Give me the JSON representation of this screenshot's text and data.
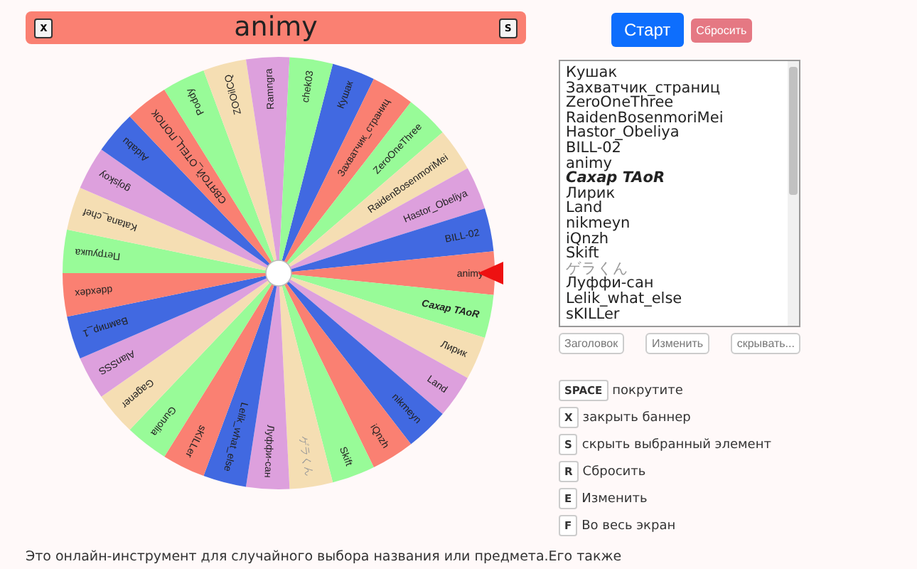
{
  "banner": {
    "close_key": "x",
    "title": "animy",
    "hide_key": "s"
  },
  "wheel": {
    "items": [
      {
        "label": "Кушак",
        "highlighted": false,
        "dimmed": false
      },
      {
        "label": "Захватчик_страниц",
        "highlighted": false,
        "dimmed": false
      },
      {
        "label": "ZeroOneThree",
        "highlighted": false,
        "dimmed": false
      },
      {
        "label": "RaidenBosenmoriMei",
        "highlighted": false,
        "dimmed": false
      },
      {
        "label": "Hastor_Obeliya",
        "highlighted": false,
        "dimmed": false
      },
      {
        "label": "BILL-02",
        "highlighted": false,
        "dimmed": false
      },
      {
        "label": "animy",
        "highlighted": false,
        "dimmed": false
      },
      {
        "label": "Сахар  TAoR",
        "highlighted": true,
        "dimmed": false
      },
      {
        "label": "Лирик",
        "highlighted": false,
        "dimmed": false
      },
      {
        "label": "Land",
        "highlighted": false,
        "dimmed": false
      },
      {
        "label": "nikmeyn",
        "highlighted": false,
        "dimmed": false
      },
      {
        "label": "iQnzh",
        "highlighted": false,
        "dimmed": false
      },
      {
        "label": "Skift",
        "highlighted": false,
        "dimmed": false
      },
      {
        "label": "ゲラくん",
        "highlighted": false,
        "dimmed": true
      },
      {
        "label": "Луффи-сан",
        "highlighted": false,
        "dimmed": false
      },
      {
        "label": "Lelik_what_else",
        "highlighted": false,
        "dimmed": false
      },
      {
        "label": "sKILLer",
        "highlighted": false,
        "dimmed": false
      },
      {
        "label": "Gunolia",
        "highlighted": false,
        "dimmed": false
      },
      {
        "label": "Gagener",
        "highlighted": false,
        "dimmed": false
      },
      {
        "label": "AlanSSS",
        "highlighted": false,
        "dimmed": false
      },
      {
        "label": "Вампир_1",
        "highlighted": false,
        "dimmed": false
      },
      {
        "label": "ddexdex",
        "highlighted": false,
        "dimmed": false
      },
      {
        "label": "Петрушка",
        "highlighted": false,
        "dimmed": false
      },
      {
        "label": "Katana_chef",
        "highlighted": false,
        "dimmed": false
      },
      {
        "label": "gojskoy",
        "highlighted": false,
        "dimmed": false
      },
      {
        "label": "Aidabu",
        "highlighted": false,
        "dimmed": false
      },
      {
        "label": "СВЯТОЙ_ОТЕЦ_ПОПОК",
        "highlighted": false,
        "dimmed": false
      },
      {
        "label": "Poddy",
        "highlighted": false,
        "dimmed": false
      },
      {
        "label": "ZOOilCQ",
        "highlighted": false,
        "dimmed": false
      },
      {
        "label": "Ramngra",
        "highlighted": false,
        "dimmed": false
      },
      {
        "label": "chek03",
        "highlighted": false,
        "dimmed": false
      }
    ]
  },
  "buttons": {
    "start": "Старт",
    "reset": "Сбросить"
  },
  "list": {
    "items": [
      {
        "text": "Кушак",
        "highlighted": false,
        "dimmed": false
      },
      {
        "text": "Захватчик_страниц",
        "highlighted": false,
        "dimmed": false
      },
      {
        "text": "ZeroOneThree",
        "highlighted": false,
        "dimmed": false
      },
      {
        "text": "RaidenBosenmoriMei",
        "highlighted": false,
        "dimmed": false
      },
      {
        "text": "Hastor_Obeliya",
        "highlighted": false,
        "dimmed": false
      },
      {
        "text": "BILL-02",
        "highlighted": false,
        "dimmed": false
      },
      {
        "text": "animy",
        "highlighted": false,
        "dimmed": false
      },
      {
        "text": "Сахар  TAoR",
        "highlighted": true,
        "dimmed": false
      },
      {
        "text": "Лирик",
        "highlighted": false,
        "dimmed": false
      },
      {
        "text": "Land",
        "highlighted": false,
        "dimmed": false
      },
      {
        "text": "nikmeyn",
        "highlighted": false,
        "dimmed": false
      },
      {
        "text": "iQnzh",
        "highlighted": false,
        "dimmed": false
      },
      {
        "text": "Skift",
        "highlighted": false,
        "dimmed": false
      },
      {
        "text": "ゲラくん",
        "highlighted": false,
        "dimmed": true
      },
      {
        "text": "Луффи-сан",
        "highlighted": false,
        "dimmed": false
      },
      {
        "text": "Lelik_what_else",
        "highlighted": false,
        "dimmed": false
      },
      {
        "text": "sKILLer",
        "highlighted": false,
        "dimmed": false
      }
    ],
    "actions": [
      "Заголовок",
      "Изменить",
      "скрывать..."
    ]
  },
  "shortcuts": [
    {
      "key": "SPACE",
      "action": "покрутите"
    },
    {
      "key": "X",
      "action": "закрыть баннер"
    },
    {
      "key": "S",
      "action": "скрыть выбранный элемент"
    },
    {
      "key": "R",
      "action": "Сбросить"
    },
    {
      "key": "E",
      "action": "Изменить"
    },
    {
      "key": "F",
      "action": "Во весь экран"
    }
  ],
  "description": "Это онлайн-инструмент для случайного выбора названия или предмета.Его также"
}
